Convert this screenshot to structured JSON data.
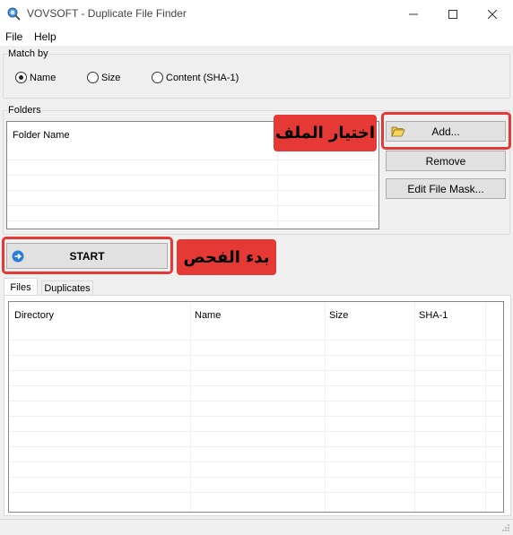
{
  "window": {
    "title": "VOVSOFT - Duplicate File Finder",
    "icon": "app-search-icon",
    "controls": [
      "minimize-icon",
      "maximize-icon",
      "close-icon"
    ]
  },
  "menu": {
    "items": [
      "File",
      "Help"
    ]
  },
  "match_by": {
    "label": "Match by",
    "options": [
      {
        "label": "Name",
        "checked": true
      },
      {
        "label": "Size",
        "checked": false
      },
      {
        "label": "Content (SHA-1)",
        "checked": false
      }
    ]
  },
  "folders": {
    "label": "Folders",
    "column_header": "Folder Name",
    "add_label": "Add...",
    "add_icon": "folder-open-icon",
    "remove_label": "Remove",
    "edit_mask_label": "Edit File Mask..."
  },
  "start": {
    "label": "START",
    "icon": "arrow-right-circle-icon"
  },
  "annotations": {
    "choose_file": "اختيار الملف",
    "start_scan": "بدء الفحص",
    "color": "#e53935"
  },
  "tabs": [
    "Files",
    "Duplicates"
  ],
  "results": {
    "columns": [
      "Directory",
      "Name",
      "Size",
      "SHA-1"
    ]
  }
}
